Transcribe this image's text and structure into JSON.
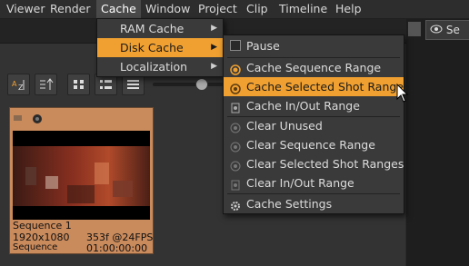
{
  "menubar": {
    "items": [
      "Viewer",
      "Render",
      "Cache",
      "Window",
      "Project",
      "Clip",
      "Timeline",
      "Help"
    ]
  },
  "cache_menu": {
    "items": [
      {
        "label": "RAM Cache"
      },
      {
        "label": "Disk Cache"
      },
      {
        "label": "Localization"
      }
    ]
  },
  "disk_cache_menu": {
    "items": [
      {
        "label": "Pause",
        "icon": "checkbox-icon"
      },
      {
        "label": "Cache Sequence Range",
        "icon": "radio-on-icon"
      },
      {
        "label": "Cache Selected Shot Ranges",
        "icon": "spinner-icon"
      },
      {
        "label": "Cache In/Out Range",
        "icon": "inout-icon"
      },
      {
        "label": "Clear Unused",
        "icon": "clear-icon"
      },
      {
        "label": "Clear Sequence Range",
        "icon": "clear-icon"
      },
      {
        "label": "Clear Selected Shot Ranges",
        "icon": "clear-icon"
      },
      {
        "label": "Clear In/Out Range",
        "icon": "clear-icon"
      },
      {
        "label": "Cache Settings",
        "icon": "gear-icon"
      }
    ]
  },
  "clip": {
    "name": "Sequence 1",
    "resolution": "1920x1080",
    "frames_fps": "353f @24FPS",
    "type": "Sequence",
    "timecode": "01:00:00:00"
  },
  "viewer_tab": {
    "label": "Se"
  },
  "colors": {
    "highlight": "#f0a030",
    "card": "#c98a5c"
  }
}
